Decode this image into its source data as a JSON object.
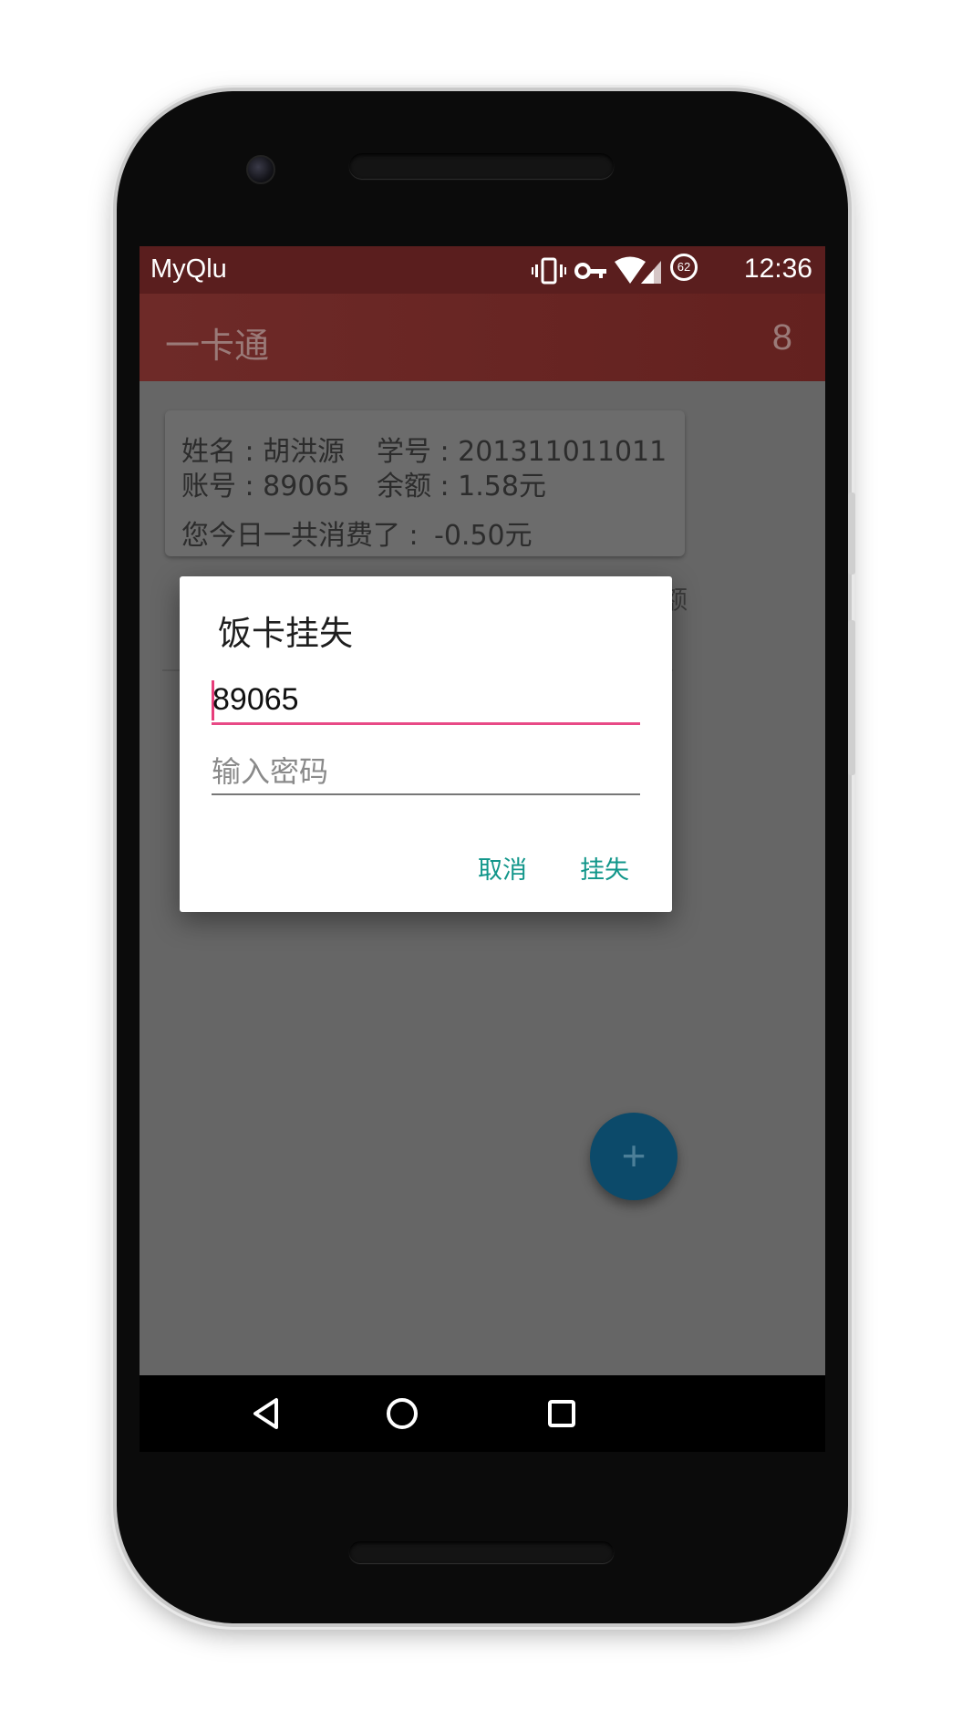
{
  "status_bar": {
    "app_name": "MyQlu",
    "time": "12:36",
    "battery_level": "62",
    "icons": [
      "vibrate-icon",
      "key-icon",
      "wifi-icon",
      "signal-icon",
      "battery-icon"
    ]
  },
  "app_bar": {
    "title": "一卡通",
    "count": "8"
  },
  "card": {
    "name_label": "姓名 : 胡洪源",
    "student_id_label": "学号 : 201311011011",
    "account_label": "账号 : 89065",
    "balance_label": "余额 : 1.58元",
    "spent_today_label": "您今日一共消费了 :",
    "spent_today_value": "-0.50元"
  },
  "peek_text": "额",
  "dialog": {
    "title": "饭卡挂失",
    "account_value": "89065",
    "password_placeholder": "输入密码",
    "cancel_label": "取消",
    "confirm_label": "挂失"
  },
  "fab": {
    "label": "+"
  },
  "colors": {
    "status_bar": "#5a1e1e",
    "app_bar": "#6a2624",
    "accent": "#e84a86",
    "button_text": "#11968a",
    "fab": "#0c4a6a"
  }
}
